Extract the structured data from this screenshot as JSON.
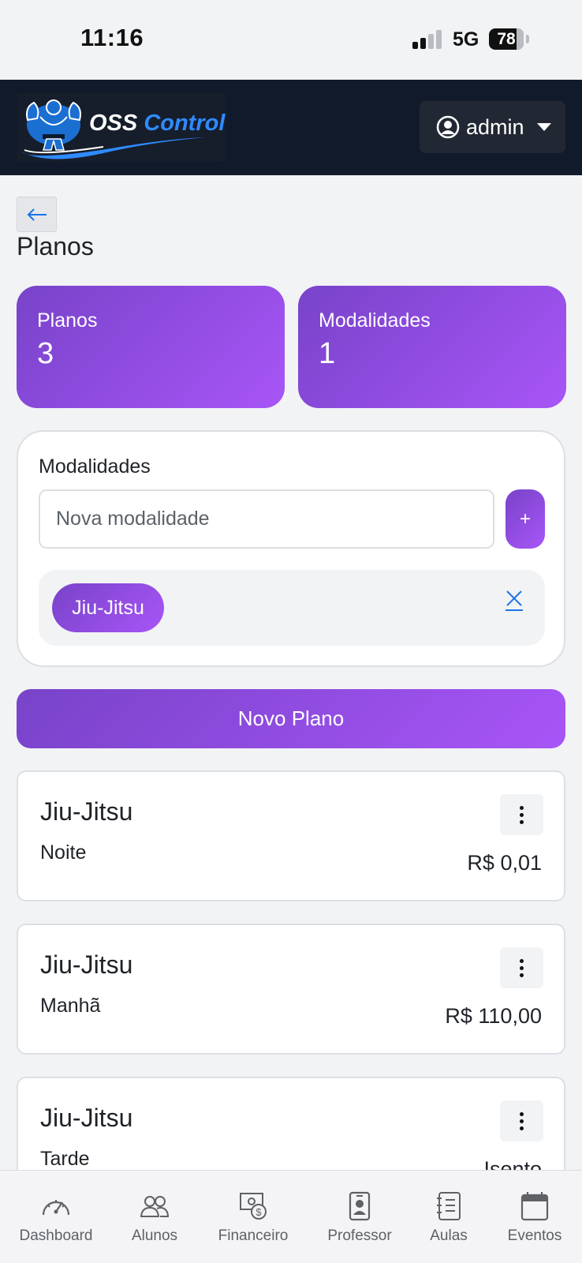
{
  "status_bar": {
    "time": "11:16",
    "network": "5G",
    "battery": "78"
  },
  "header": {
    "logo_text_oss": "OSS",
    "logo_text_control": "Control",
    "user_menu_label": "admin"
  },
  "page": {
    "title": "Planos"
  },
  "stats": [
    {
      "label": "Planos",
      "value": "3"
    },
    {
      "label": "Modalidades",
      "value": "1"
    }
  ],
  "modalidades": {
    "title": "Modalidades",
    "input_placeholder": "Nova modalidade",
    "add_label": "+",
    "items": [
      {
        "label": "Jiu-Jitsu"
      }
    ]
  },
  "novo_plano_label": "Novo Plano",
  "plans": [
    {
      "name": "Jiu-Jitsu",
      "period": "Noite",
      "price": "R$ 0,01"
    },
    {
      "name": "Jiu-Jitsu",
      "period": "Manhã",
      "price": "R$ 110,00"
    },
    {
      "name": "Jiu-Jitsu",
      "period": "Tarde",
      "price": "Isento"
    }
  ],
  "bottom_nav": [
    {
      "label": "Dashboard",
      "icon": "speedometer-icon"
    },
    {
      "label": "Alunos",
      "icon": "people-icon"
    },
    {
      "label": "Financeiro",
      "icon": "cash-icon"
    },
    {
      "label": "Professor",
      "icon": "badge-icon"
    },
    {
      "label": "Aulas",
      "icon": "notebook-icon"
    },
    {
      "label": "Eventos",
      "icon": "calendar-icon"
    }
  ],
  "colors": {
    "header_bg": "#111a2b",
    "accent_gradient_start": "#7843c9",
    "accent_gradient_end": "#a855f7",
    "link_blue": "#1a73e8"
  }
}
